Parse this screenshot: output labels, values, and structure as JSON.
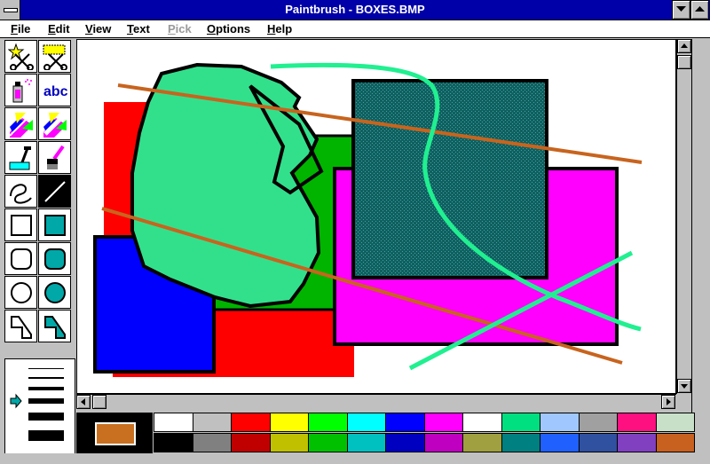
{
  "window": {
    "title": "Paintbrush - BOXES.BMP",
    "title_bar_color": "#0000a8"
  },
  "menu": [
    {
      "label": "File",
      "accel": "F",
      "rest": "ile",
      "enabled": true
    },
    {
      "label": "Edit",
      "accel": "E",
      "rest": "dit",
      "enabled": true
    },
    {
      "label": "View",
      "accel": "V",
      "rest": "iew",
      "enabled": true
    },
    {
      "label": "Text",
      "accel": "T",
      "rest": "ext",
      "enabled": true
    },
    {
      "label": "Pick",
      "accel": "P",
      "rest": "ick",
      "enabled": false
    },
    {
      "label": "Options",
      "accel": "O",
      "rest": "ptions",
      "enabled": true
    },
    {
      "label": "Help",
      "accel": "H",
      "rest": "elp",
      "enabled": true
    }
  ],
  "toolbox": {
    "tools": [
      {
        "name": "scissors-star-icon"
      },
      {
        "name": "scissors-box-icon"
      },
      {
        "name": "airbrush-icon"
      },
      {
        "name": "text-tool-icon",
        "label": "abc"
      },
      {
        "name": "color-eraser-icon"
      },
      {
        "name": "eraser-icon"
      },
      {
        "name": "paint-roller-icon"
      },
      {
        "name": "brush-icon"
      },
      {
        "name": "curve-icon"
      },
      {
        "name": "line-icon",
        "selected": true
      },
      {
        "name": "box-icon"
      },
      {
        "name": "filled-box-icon"
      },
      {
        "name": "rounded-box-icon"
      },
      {
        "name": "filled-rounded-box-icon"
      },
      {
        "name": "circle-icon"
      },
      {
        "name": "filled-circle-icon"
      },
      {
        "name": "polygon-icon"
      },
      {
        "name": "filled-polygon-icon"
      }
    ],
    "line_widths_count": 6,
    "selected_line_width_index": 0
  },
  "palette": {
    "foreground": "#c87020",
    "background": "#000000",
    "top_row": [
      "#ffffff",
      "#c0c0c0",
      "#ff0000",
      "#ffff00",
      "#00ff00",
      "#00ffff",
      "#0000ff",
      "#ff00ff",
      "#ffffff",
      "#00e080",
      "#a0c8ff",
      "#a0a0a0",
      "#ff1080",
      "#c8e0c8"
    ],
    "bottom_row": [
      "#000000",
      "#808080",
      "#c00000",
      "#c0c000",
      "#00c000",
      "#00c0c0",
      "#0000c0",
      "#c000c0",
      "#a0a040",
      "#008080",
      "#2060ff",
      "#3050a0",
      "#8040c0",
      "#c86020"
    ]
  },
  "canvas": {
    "shape_colors": {
      "red": "#ff0000",
      "blue": "#0000ff",
      "green": "#00b400",
      "mint": "#32e08c",
      "teal": "#106060",
      "magenta": "#ff00ff",
      "orange_line": "#c8641e",
      "green_line": "#20f090",
      "outline": "#000000"
    }
  }
}
